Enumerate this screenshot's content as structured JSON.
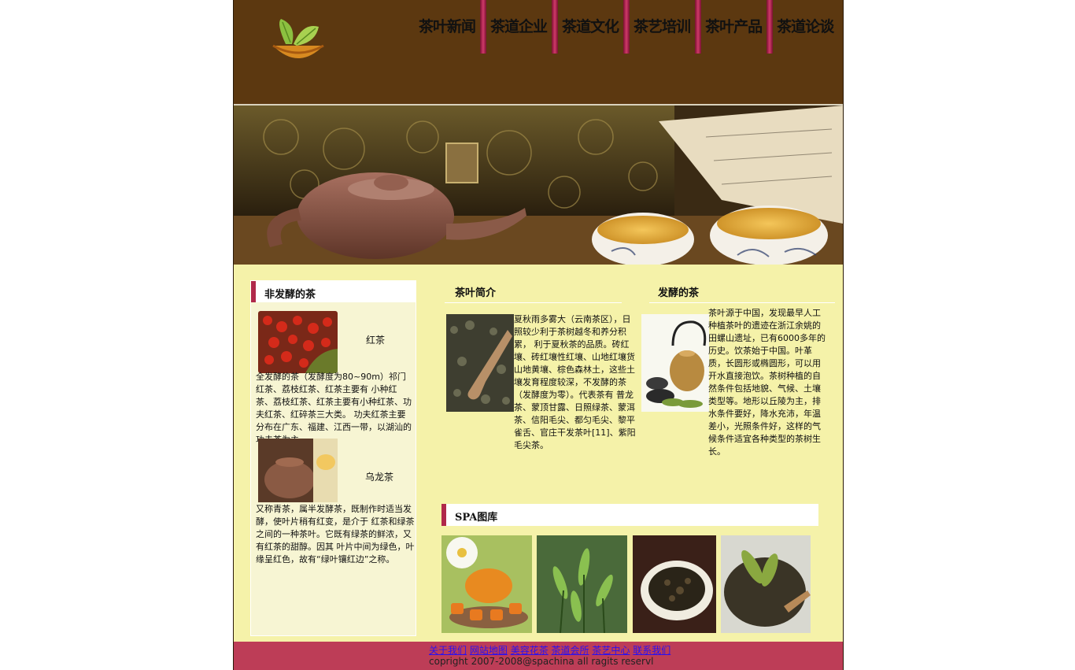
{
  "nav": {
    "items": [
      "茶叶新闻",
      "茶道企业",
      "茶道文化",
      "茶艺培训",
      "茶叶产品",
      "茶道论谈"
    ]
  },
  "colors": {
    "header_bg": "#5c3810",
    "page_bg": "#f5f2a9",
    "accent": "#b0294a",
    "footer_bg": "#bd3d57",
    "link": "#2a10f0"
  },
  "sidebar": {
    "title": "非发酵的茶",
    "items": [
      {
        "label": "红茶",
        "image": "red-tea-image",
        "text": "全发酵的茶（发酵度为80~90m）祁门红茶、荔枝红茶、红茶主要有 小种红茶、荔枝红茶、红茶主要有小种红茶、功夫红茶、红碎茶三大类。 功夫红茶主要分布在广东、福建、江西一带，以湖汕的功夫茶为主。"
      },
      {
        "label": "乌龙茶",
        "image": "oolong-teapot-image",
        "text": "又称青茶，属半发酵茶，既制作时适当发酵，使叶片稍有红变，是介于 红茶和绿茶之间的一种茶叶。它既有绿茶的鲜浓，又有红茶的甜醇。因其 叶片中间为绿色，叶缘呈红色，故有“绿叶镶红边”之称。"
      }
    ]
  },
  "intro": {
    "title": "茶叶简介",
    "image": "dry-tea-scoop-image",
    "text": "夏秋雨多雾大（云南茶区），日照较少利于茶树越冬和养分积累， 利于夏秋茶的品质。砖红壤、砖红壤性红壤、山地红壤货山地黄壤、棕色森林土，这些土壤发育程度较深，不发酵的茶（发酵度为零）。代表茶有 普龙茶、蒙顶甘露、日照绿茶、蒙洱茶、信阳毛尖、都匀毛尖、黎平 雀舌、官庄干发茶叶[11]、紫阳毛尖茶。"
  },
  "fermented": {
    "title": "发酵的茶",
    "image": "tea-kettle-image",
    "text": "茶叶源于中国，发现最早人工种植茶叶的遗迹在浙江余姚的田螺山遗址，已有6000多年的历史。饮茶始于中国。叶革质，长圆形或椭圆形，可以用开水直接泡饮。茶树种植的自然条件包括地貌、气候、土壤类型等。地形以丘陵为主，排水条件要好，降水充沛，年温差小，光照条件好，这样的气候条件适宜各种类型的茶树生长。"
  },
  "gallery": {
    "title": "SPA图库",
    "images": [
      "tea-set-flower-image",
      "tea-plant-image",
      "tea-bowl-image",
      "tea-leaves-spoon-image"
    ]
  },
  "footer": {
    "links": [
      "关于我们",
      "网站地图",
      "美容花茶",
      "茶道会所",
      "茶艺中心",
      "联系我们"
    ],
    "copyright": "copright 2007-2008@spachina all ragits reservl"
  }
}
